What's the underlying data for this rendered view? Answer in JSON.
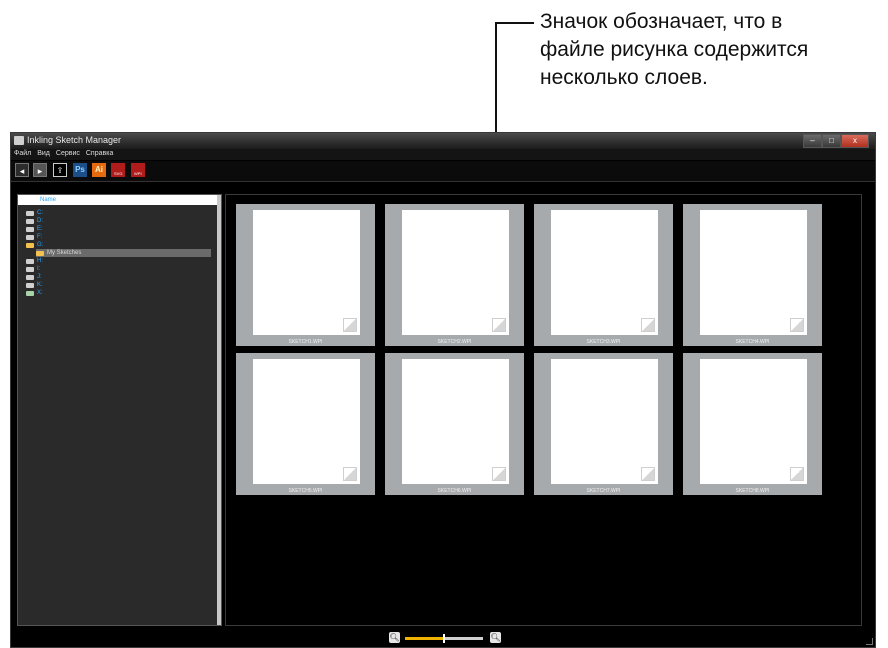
{
  "annotation": {
    "lines": [
      "Значок обозначает, что в",
      "файле рисунка содержится",
      "несколько слоев."
    ]
  },
  "window": {
    "title": "Inkling Sketch Manager",
    "controls": [
      "–",
      "□",
      "x"
    ]
  },
  "menu": [
    "Файл",
    "Вид",
    "Сервис",
    "Справка"
  ],
  "toolbar": {
    "back_icon": "back-arrow-icon",
    "forward_icon": "forward-arrow-icon",
    "export_icon": "export-icon",
    "ps_label": "Ps",
    "ai_label": "Ai",
    "wacom_svg_badge": "SVG",
    "wacom_wpi_badge": "WPI"
  },
  "tree": {
    "header": "Name",
    "drives": [
      {
        "label": "C:",
        "kind": "drive"
      },
      {
        "label": "D:",
        "kind": "drive"
      },
      {
        "label": "E:",
        "kind": "drive"
      },
      {
        "label": "F:",
        "kind": "drive"
      },
      {
        "label": "G:",
        "kind": "folder"
      },
      {
        "label": "My Sketches",
        "kind": "child",
        "selected": true
      },
      {
        "label": "H:",
        "kind": "drive"
      },
      {
        "label": "I:",
        "kind": "drive"
      },
      {
        "label": "J:",
        "kind": "drive"
      },
      {
        "label": "K:",
        "kind": "drive"
      },
      {
        "label": "X:",
        "kind": "disc"
      }
    ]
  },
  "files": [
    "SKETCH1.WPI",
    "SKETCH2.WPI",
    "SKETCH3.WPI",
    "SKETCH4.WPI",
    "SKETCH5.WPI",
    "SKETCH6.WPI",
    "SKETCH7.WPI",
    "SKETCH8.WPI"
  ],
  "zoom": {
    "out_icon": "zoom-out-icon",
    "in_icon": "zoom-in-icon",
    "level": 0.5
  },
  "colors": {
    "accent_tree_text": "#2aa3ff",
    "thumb_border": "#a7aaad",
    "zoom_fill": "#f0b400"
  }
}
